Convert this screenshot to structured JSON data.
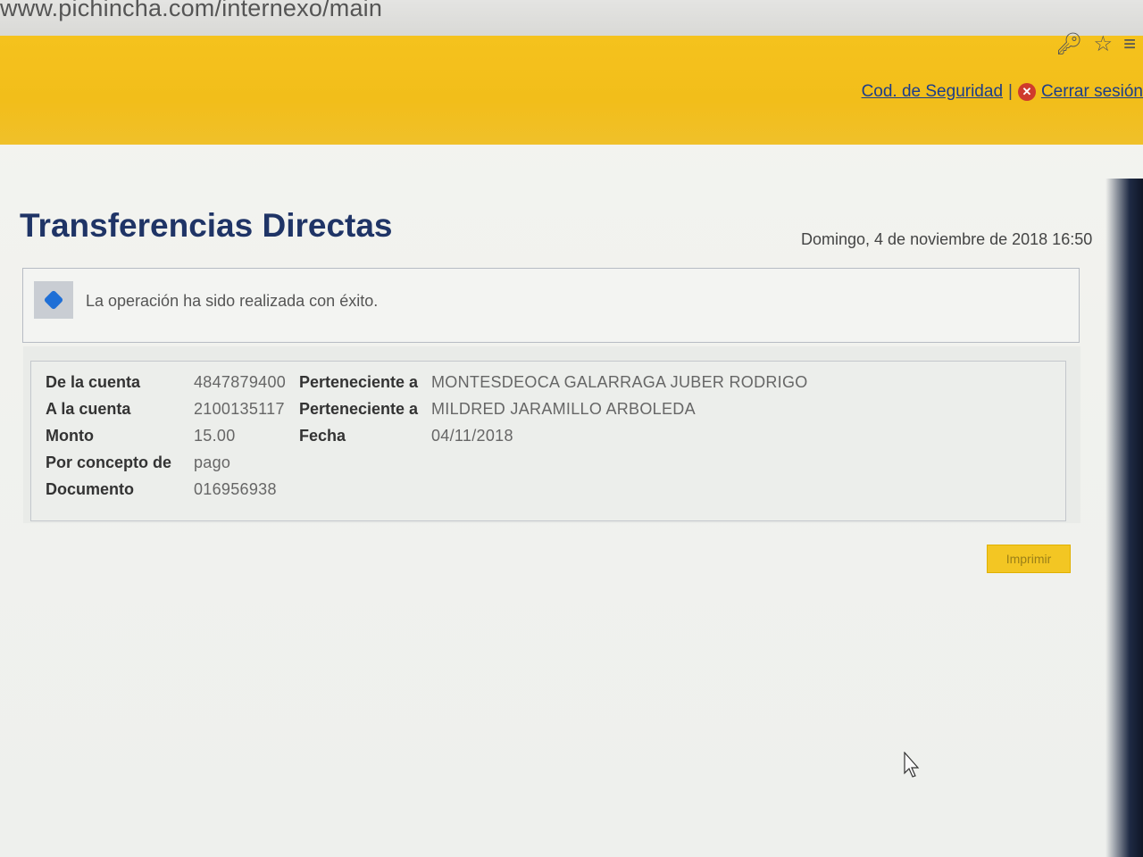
{
  "browser": {
    "url": "www.pichincha.com/internexo/main",
    "icons": [
      "key-icon",
      "star-icon",
      "menu-icon"
    ]
  },
  "header": {
    "security_code_link": "Cod. de Seguridad",
    "separator": "|",
    "logout_link": "Cerrar sesión"
  },
  "page": {
    "title": "Transferencias Directas",
    "datetime": "Domingo, 4 de noviembre de 2018 16:50"
  },
  "message": {
    "text": "La operación ha sido realizada con éxito."
  },
  "details": {
    "rows": [
      {
        "label": "De la cuenta",
        "value": "4847879400",
        "label2": "Perteneciente a",
        "value2": "MONTESDEOCA GALARRAGA JUBER RODRIGO"
      },
      {
        "label": "A la cuenta",
        "value": "2100135117",
        "label2": "Perteneciente a",
        "value2": "MILDRED JARAMILLO ARBOLEDA"
      },
      {
        "label": "Monto",
        "value": "15.00",
        "label2": "Fecha",
        "value2": "04/11/2018"
      },
      {
        "label": "Por concepto de",
        "value": "pago"
      },
      {
        "label": "Documento",
        "value": "016956938"
      }
    ]
  },
  "actions": {
    "print_label": "Imprimir"
  },
  "colors": {
    "banner": "#f2be1a",
    "title": "#1f3466",
    "link": "#1c3d8a",
    "info": "#1f6fd6"
  }
}
